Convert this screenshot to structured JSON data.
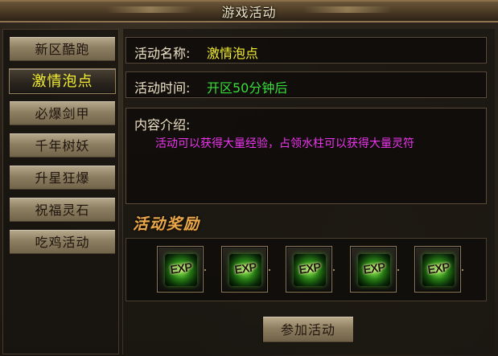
{
  "window": {
    "title": "游戏活动"
  },
  "menu": {
    "items": [
      {
        "label": "新区酷跑",
        "active": false
      },
      {
        "label": "激情泡点",
        "active": true
      },
      {
        "label": "必爆剑甲",
        "active": false
      },
      {
        "label": "千年树妖",
        "active": false
      },
      {
        "label": "升星狂爆",
        "active": false
      },
      {
        "label": "祝福灵石",
        "active": false
      },
      {
        "label": "吃鸡活动",
        "active": false
      }
    ]
  },
  "details": {
    "name_label": "活动名称:",
    "name_value": "激情泡点",
    "time_label": "活动时间:",
    "time_value": "开区50分钟后",
    "content_label": "内容介绍:",
    "content_text": "活动可以获得大量经验，占领水柱可以获得大量灵符"
  },
  "rewards": {
    "title": "活动奖励",
    "items": [
      {
        "icon": "exp-icon",
        "text": "EXP"
      },
      {
        "icon": "exp-icon",
        "text": "EXP"
      },
      {
        "icon": "exp-icon",
        "text": "EXP"
      },
      {
        "icon": "exp-icon",
        "text": "EXP"
      },
      {
        "icon": "exp-icon",
        "text": "EXP"
      }
    ]
  },
  "actions": {
    "join_label": "参加活动"
  },
  "colors": {
    "menu_active": "#f4ef32",
    "activity_time": "#39df39",
    "content_text": "#ee34ef",
    "reward_title": "#e8a94c"
  }
}
